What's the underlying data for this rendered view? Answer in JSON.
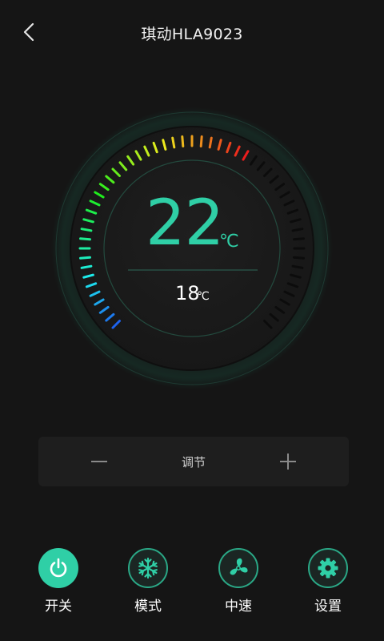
{
  "header": {
    "title": "琪动HLA9023"
  },
  "thermostat": {
    "set_temp": "22",
    "set_unit": "℃",
    "current_temp": "18",
    "current_unit": "℃",
    "level": 0.62
  },
  "adjust": {
    "label": "调节",
    "minus_icon": "minus-icon",
    "plus_icon": "plus-icon"
  },
  "controls": [
    {
      "label": "开关",
      "icon": "power-icon",
      "active": true
    },
    {
      "label": "模式",
      "icon": "snowflake-icon",
      "active": false
    },
    {
      "label": "中速",
      "icon": "fan-icon",
      "active": false
    },
    {
      "label": "设置",
      "icon": "gear-icon",
      "active": false
    }
  ],
  "colors": {
    "accent": "#2fcfa6",
    "background": "#151515"
  }
}
